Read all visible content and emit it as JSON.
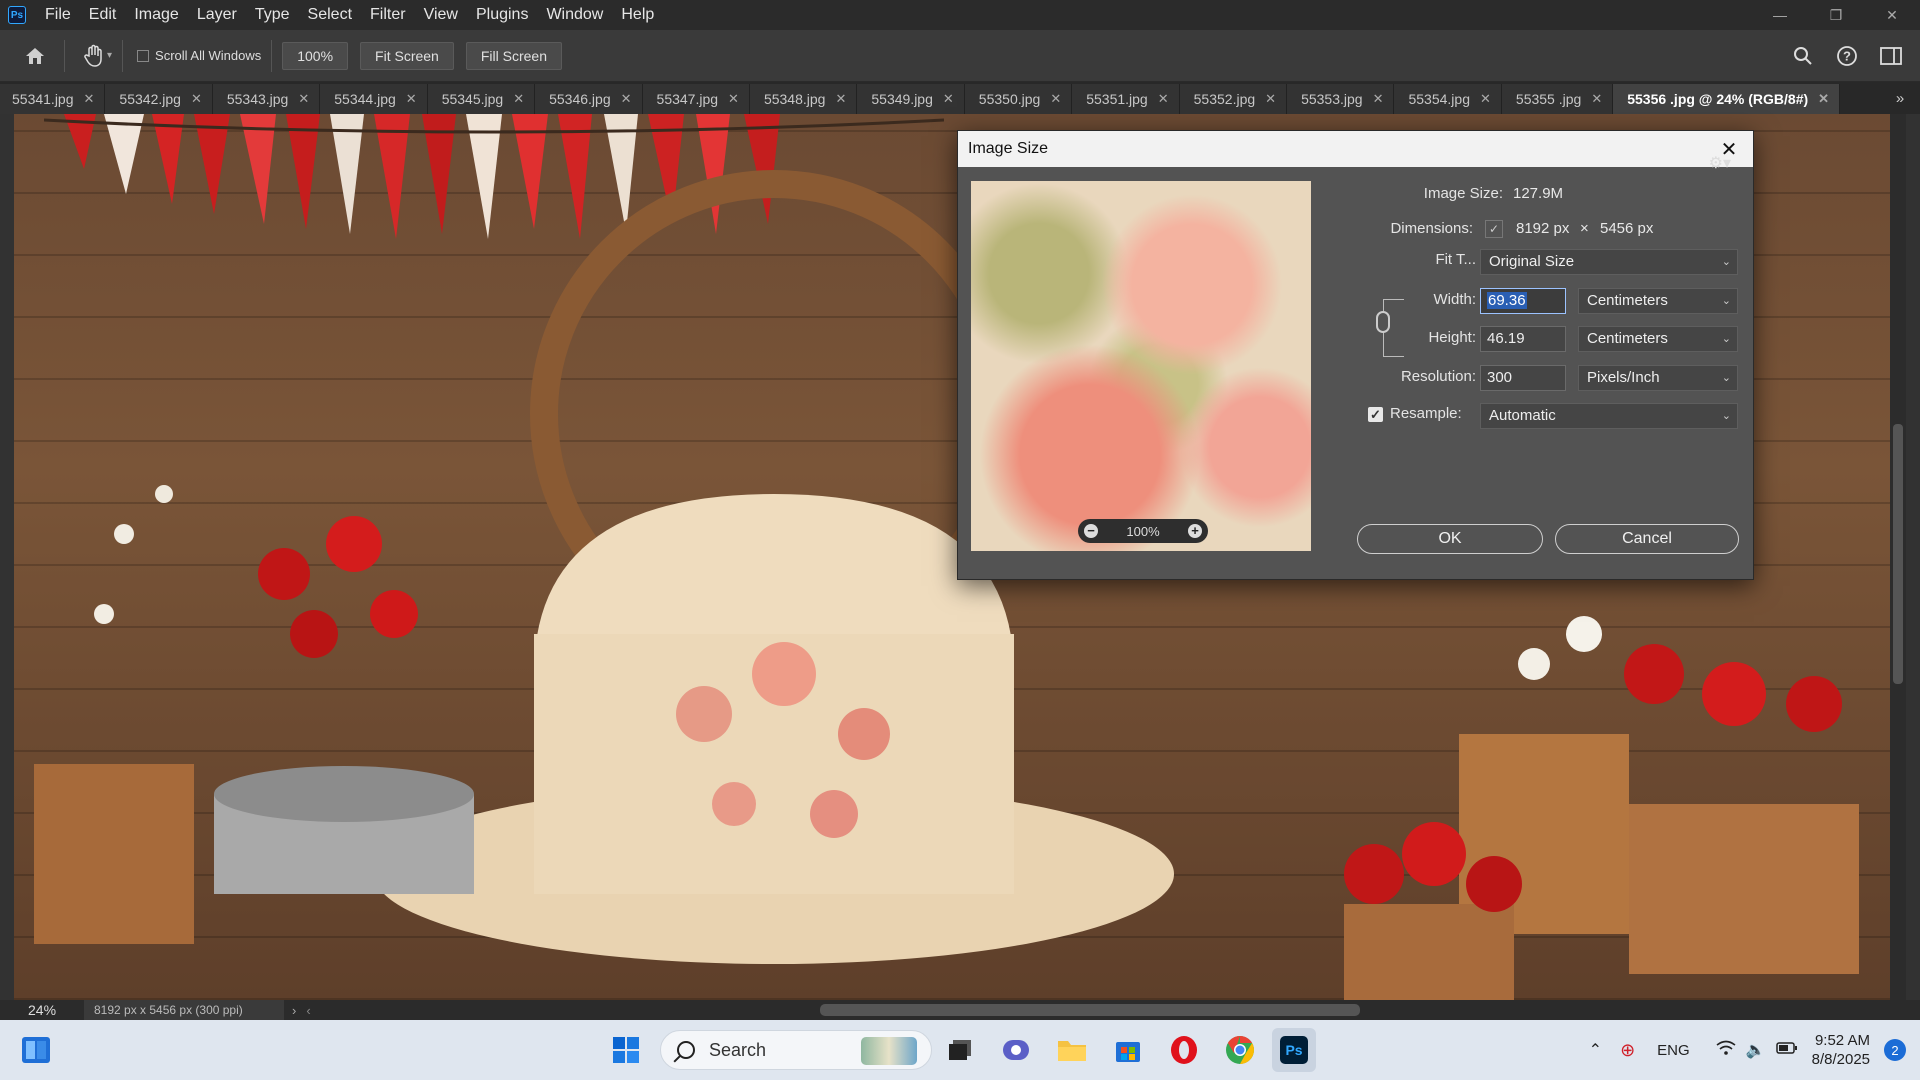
{
  "app": {
    "logo": "Ps",
    "menu": [
      "File",
      "Edit",
      "Image",
      "Layer",
      "Type",
      "Select",
      "Filter",
      "View",
      "Plugins",
      "Window",
      "Help"
    ]
  },
  "options_bar": {
    "scroll_all_windows_label": "Scroll All Windows",
    "zoom_value": "100%",
    "fit_screen_label": "Fit Screen",
    "fill_screen_label": "Fill Screen"
  },
  "tabs": [
    {
      "label": "55341.jpg",
      "active": false
    },
    {
      "label": "55342.jpg",
      "active": false
    },
    {
      "label": "55343.jpg",
      "active": false
    },
    {
      "label": "55344.jpg",
      "active": false
    },
    {
      "label": "55345.jpg",
      "active": false
    },
    {
      "label": "55346.jpg",
      "active": false
    },
    {
      "label": "55347.jpg",
      "active": false
    },
    {
      "label": "55348.jpg",
      "active": false
    },
    {
      "label": "55349.jpg",
      "active": false
    },
    {
      "label": "55350.jpg",
      "active": false
    },
    {
      "label": "55351.jpg",
      "active": false
    },
    {
      "label": "55352.jpg",
      "active": false
    },
    {
      "label": "55353.jpg",
      "active": false
    },
    {
      "label": "55354.jpg",
      "active": false
    },
    {
      "label": "55355 .jpg",
      "active": false
    },
    {
      "label": "55356 .jpg @ 24% (RGB/8#)",
      "active": true
    }
  ],
  "status_bar": {
    "zoom": "24%",
    "doc_info": "8192 px x 5456 px (300 ppi)"
  },
  "dialog": {
    "title": "Image Size",
    "image_size_label": "Image Size:",
    "image_size_value": "127.9M",
    "dimensions_label": "Dimensions:",
    "dimensions_width": "8192 px",
    "dimensions_x": "×",
    "dimensions_height": "5456 px",
    "fit_to_label": "Fit T...",
    "fit_to_value": "Original Size",
    "width_label": "Width:",
    "width_value": "69.36",
    "width_unit": "Centimeters",
    "height_label": "Height:",
    "height_value": "46.19",
    "height_unit": "Centimeters",
    "resolution_label": "Resolution:",
    "resolution_value": "300",
    "resolution_unit": "Pixels/Inch",
    "resample_label": "Resample:",
    "resample_checked": true,
    "resample_value": "Automatic",
    "preview_zoom": "100%",
    "ok_label": "OK",
    "cancel_label": "Cancel"
  },
  "taskbar": {
    "search_placeholder": "Search",
    "language": "ENG",
    "time": "9:52 AM",
    "date": "8/8/2025",
    "notification_count": "2"
  },
  "colors": {
    "ps_blue": "#31a8ff",
    "windows_blue": "#1b6cd6",
    "opera_red": "#e0121c"
  }
}
